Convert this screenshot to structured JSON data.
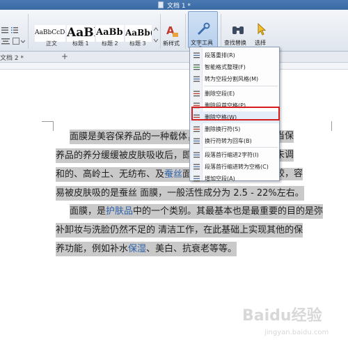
{
  "window": {
    "title": "文档 1 *"
  },
  "ribbon": {
    "styles": [
      {
        "preview": "AaBbCcDd",
        "label": "正文"
      },
      {
        "preview": "AaBl",
        "label": "标题 1"
      },
      {
        "preview": "AaBb(",
        "label": "标题 2"
      },
      {
        "preview": "AaBb(",
        "label": "标题 3"
      }
    ],
    "new_style_label": "新样式",
    "text_tools_label": "文字工具",
    "find_replace_label": "查找替换",
    "select_label": "选择"
  },
  "tabs": {
    "doc_tab": "文档 2 *",
    "add_tab": "+"
  },
  "menu": {
    "items": [
      {
        "icon": "paragraph-rearrange-icon",
        "label": "段落重排(R)"
      },
      {
        "icon": "smart-format-icon",
        "label": "智能格式整理(F)"
      },
      {
        "icon": "space-split-style-icon",
        "label": "转为空段分割风格(M)"
      },
      {
        "icon": "delete-empty-para-icon",
        "label": "删除空段(E)"
      },
      {
        "icon": "delete-leading-space-icon",
        "label": "删除段首空格(P)"
      },
      {
        "icon": "delete-space-icon",
        "label": "删除空格(W)"
      },
      {
        "icon": "delete-linebreak-icon",
        "label": "删除换行符(S)"
      },
      {
        "icon": "linebreak-to-enter-icon",
        "label": "换行符转为回车(B)"
      },
      {
        "icon": "indent-2-chars-icon",
        "label": "段落首行缩进2字符(I)"
      },
      {
        "icon": "indent-to-space-icon",
        "label": "段落首行缩进转为空格(C)"
      },
      {
        "icon": "add-empty-para-icon",
        "label": "增加空段(A)"
      }
    ],
    "selected_index": 5
  },
  "document": {
    "lines_p1": [
      [
        {
          "t": "面膜是美容保养品的一种载体，"
        }
      ],
      [
        {
          "t": "养品的养分缓缓被皮肤吸收后，即卸下"
        }
      ],
      [
        {
          "t": "和的、高岭土、无纺布、及"
        },
        {
          "t": "蚕丝",
          "blue": true
        },
        {
          "t": "面膜，"
        }
      ],
      [
        {
          "t": "易被皮肤吸的是蚕丝        面膜，一般活性成分为 2.5 - 22%左右。"
        }
      ]
    ],
    "lines_p1_right": [
      "当保",
      "未调",
      "较，容"
    ],
    "lines_p2": [
      [
        {
          "t": "面膜，是"
        },
        {
          "t": "护肤品",
          "blue": true
        },
        {
          "t": "中的一个类别。其最基本也是最重要的目的是弥"
        }
      ],
      [
        {
          "t": "补卸妆与洗脸仍然不足的          清洁工作，在此基础上实现其他的保"
        }
      ],
      [
        {
          "t": "养功能，例如补水"
        },
        {
          "t": "保湿",
          "blue": true
        },
        {
          "t": "、美白、抗衰老等等。"
        }
      ]
    ]
  },
  "watermark": {
    "text": "Baidu经验",
    "sub": "jingyan.baidu.com"
  }
}
